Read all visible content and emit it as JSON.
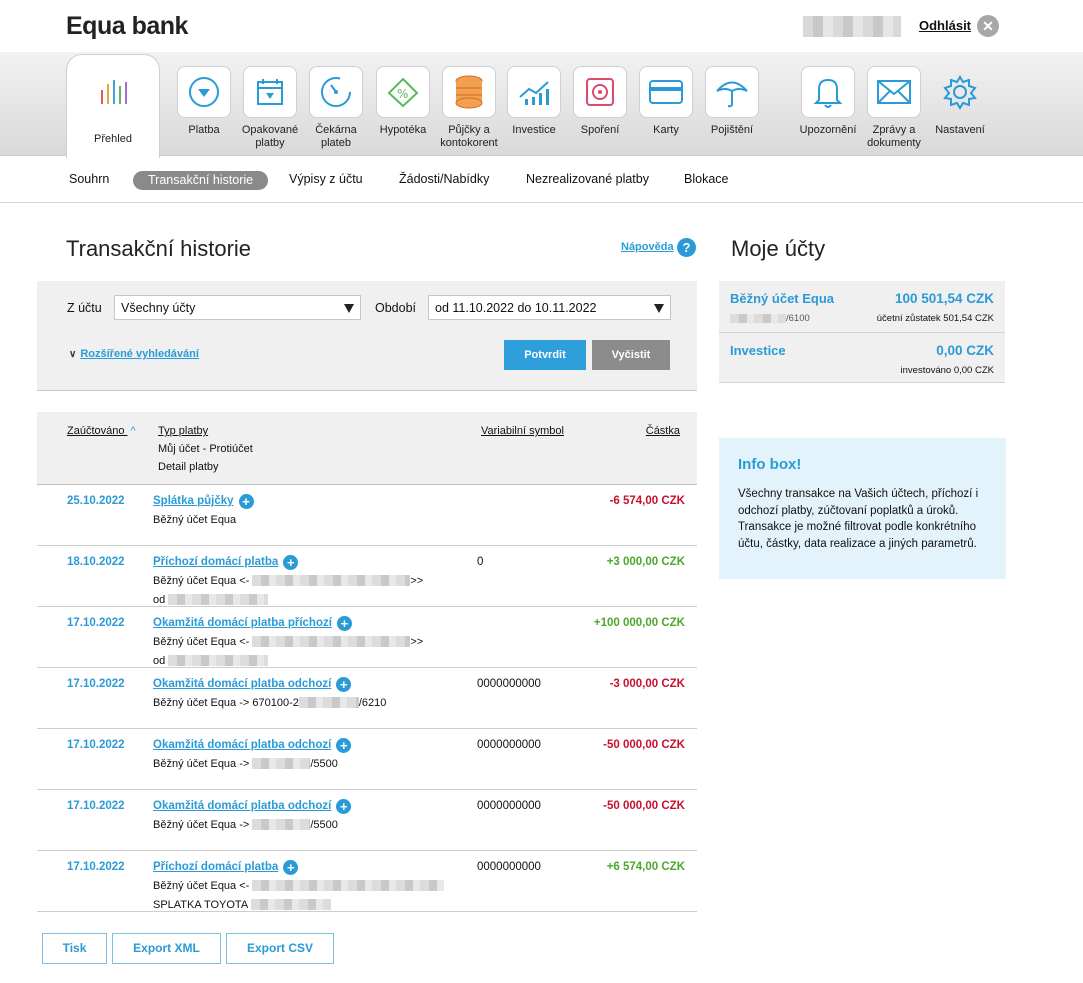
{
  "header": {
    "logo": "Equa bank",
    "logout_label": "Odhlásit",
    "close_glyph": "✕"
  },
  "icon_nav": [
    {
      "label": "Přehled",
      "icon": "bar-chart-icon"
    },
    {
      "label": "Platba",
      "icon": "payment-icon"
    },
    {
      "label": "Opakované platby",
      "icon": "calendar-icon"
    },
    {
      "label": "Čekárna plateb",
      "icon": "clock-icon"
    },
    {
      "label": "Hypotéka",
      "icon": "house-percent-icon"
    },
    {
      "label": "Půjčky a kontokorent",
      "icon": "coins-icon"
    },
    {
      "label": "Investice",
      "icon": "chart-line-icon"
    },
    {
      "label": "Spoření",
      "icon": "safe-icon"
    },
    {
      "label": "Karty",
      "icon": "card-icon"
    },
    {
      "label": "Pojištění",
      "icon": "umbrella-icon"
    },
    {
      "label": "Upozornění",
      "icon": "bell-icon"
    },
    {
      "label": "Zprávy a dokumenty",
      "icon": "envelope-icon"
    },
    {
      "label": "Nastavení",
      "icon": "gear-icon"
    }
  ],
  "sub_nav": [
    "Souhrn",
    "Transakční historie",
    "Výpisy z účtu",
    "Žádosti/Nabídky",
    "Nezrealizované platby",
    "Blokace"
  ],
  "main": {
    "title": "Transakční historie",
    "help_label": "Nápověda",
    "help_glyph": "?",
    "filter": {
      "from_account_label": "Z účtu",
      "from_account_value": "Všechny účty",
      "period_label": "Období",
      "period_value": "od 11.10.2022 do 10.11.2022",
      "advanced_search": "Rozšířené vyhledávání",
      "confirm_label": "Potvrdit",
      "clear_label": "Vyčistit"
    },
    "table_header": {
      "booked": "Zaúčtováno",
      "type": "Typ platby",
      "my_account": "Můj účet - Protiúčet",
      "detail": "Detail platby",
      "vs": "Variabilní symbol",
      "amount": "Částka"
    },
    "transactions": [
      {
        "date": "25.10.2022",
        "type": "Splátka půjčky",
        "line2": "Běžný účet Equa",
        "line3": "",
        "vs": "",
        "amount": "-6 574,00 CZK",
        "sign": "neg"
      },
      {
        "date": "18.10.2022",
        "type": "Příchozí domácí platba",
        "line2": "Běžný účet Equa <-",
        "line2_end": ">>",
        "line3": "od",
        "vs": "0",
        "amount": "+3 000,00 CZK",
        "sign": "pos"
      },
      {
        "date": "17.10.2022",
        "type": "Okamžitá domácí platba příchozí",
        "line2": "Běžný účet Equa <-",
        "line2_end": ">>",
        "line3": "od",
        "vs": "",
        "amount": "+100 000,00 CZK",
        "sign": "pos"
      },
      {
        "date": "17.10.2022",
        "type": "Okamžitá domácí platba odchozí",
        "line2": "Běžný účet Equa -> 670100-2",
        "line2_end": "/6210",
        "line3": "",
        "vs": "0000000000",
        "amount": "-3 000,00 CZK",
        "sign": "neg"
      },
      {
        "date": "17.10.2022",
        "type": "Okamžitá domácí platba odchozí",
        "line2": "Běžný účet Equa ->",
        "line2_end": "/5500",
        "line3": "",
        "vs": "0000000000",
        "amount": "-50 000,00 CZK",
        "sign": "neg"
      },
      {
        "date": "17.10.2022",
        "type": "Okamžitá domácí platba odchozí",
        "line2": "Běžný účet Equa ->",
        "line2_end": "/5500",
        "line3": "",
        "vs": "0000000000",
        "amount": "-50 000,00 CZK",
        "sign": "neg"
      },
      {
        "date": "17.10.2022",
        "type": "Příchozí domácí platba",
        "line2": "Běžný účet Equa <-",
        "line2_end": "",
        "line3": "SPLATKA TOYOTA",
        "vs": "0000000000",
        "amount": "+6 574,00 CZK",
        "sign": "pos"
      }
    ],
    "export_buttons": [
      "Tisk",
      "Export XML",
      "Export CSV"
    ]
  },
  "sidebar": {
    "title": "Moje účty",
    "accounts": [
      {
        "name": "Běžný účet Equa",
        "amount": "100 501,54 CZK",
        "sub": "/6100",
        "note": "účetní zůstatek 501,54 CZK"
      },
      {
        "name": "Investice",
        "amount": "0,00 CZK",
        "sub": "",
        "note": "investováno 0,00 CZK"
      }
    ],
    "info_box": {
      "title": "Info box!",
      "text": "Všechny transakce na Vašich účtech, příchozí i odchozí platby, zúčtovaní poplatků a úroků. Transakce je možné filtrovat podle konkrétního účtu, částky, data realizace a jiných parametrů."
    }
  },
  "colors": {
    "accent": "#2a9bd6",
    "negative": "#c8102e",
    "positive": "#4aa82a"
  }
}
